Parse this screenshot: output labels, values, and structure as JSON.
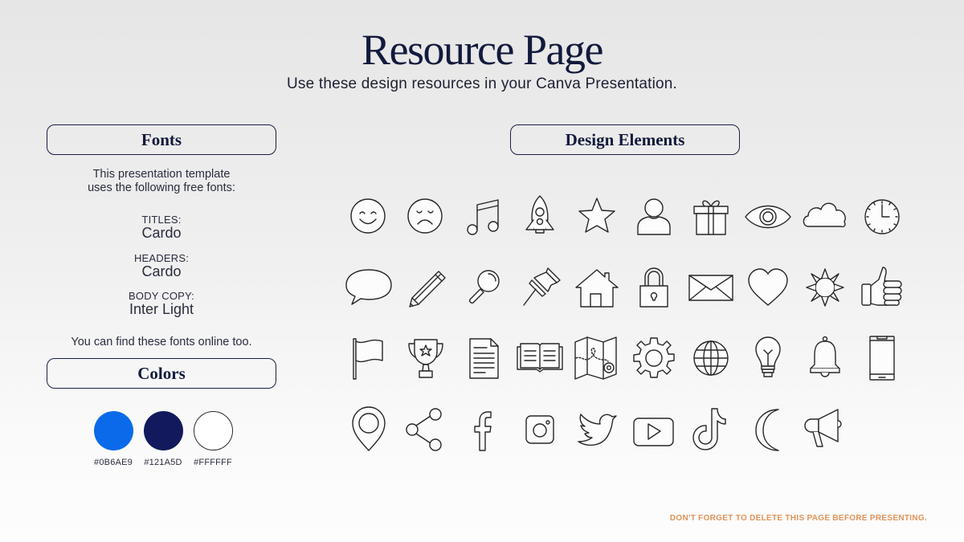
{
  "page": {
    "title": "Resource Page",
    "subtitle": "Use these design resources in your Canva Presentation."
  },
  "fonts_section": {
    "header": "Fonts",
    "intro_line1": "This presentation template",
    "intro_line2": "uses the following free fonts:",
    "entries": [
      {
        "label": "TITLES:",
        "font": "Cardo"
      },
      {
        "label": "HEADERS:",
        "font": "Cardo"
      },
      {
        "label": "BODY COPY:",
        "font": "Inter Light"
      }
    ],
    "note": "You can find these fonts online too."
  },
  "colors_section": {
    "header": "Colors",
    "swatches": [
      {
        "hex": "#0B6AE9",
        "color": "#0B6AE9"
      },
      {
        "hex": "#121A5D",
        "color": "#121A5D"
      },
      {
        "hex": "#FFFFFF",
        "color": "#FFFFFF"
      }
    ]
  },
  "design_section": {
    "header": "Design Elements",
    "icons": [
      "smiley-face-icon",
      "sad-face-icon",
      "music-note-icon",
      "rocket-icon",
      "star-icon",
      "user-icon",
      "gift-icon",
      "eye-icon",
      "cloud-icon",
      "clock-icon",
      "speech-bubble-icon",
      "pencil-icon",
      "magnifier-icon",
      "pushpin-icon",
      "house-icon",
      "padlock-icon",
      "envelope-icon",
      "heart-icon",
      "sun-icon",
      "thumbs-up-icon",
      "flag-icon",
      "trophy-icon",
      "document-icon",
      "open-book-icon",
      "map-icon",
      "gear-icon",
      "globe-icon",
      "lightbulb-icon",
      "bell-icon",
      "smartphone-icon",
      "location-pin-icon",
      "share-icon",
      "facebook-icon",
      "instagram-icon",
      "twitter-icon",
      "youtube-icon",
      "tiktok-icon",
      "moon-icon",
      "megaphone-icon"
    ]
  },
  "footer": {
    "note": "DON'T FORGET TO DELETE THIS PAGE BEFORE PRESENTING.",
    "note_color": "#E0935A"
  }
}
